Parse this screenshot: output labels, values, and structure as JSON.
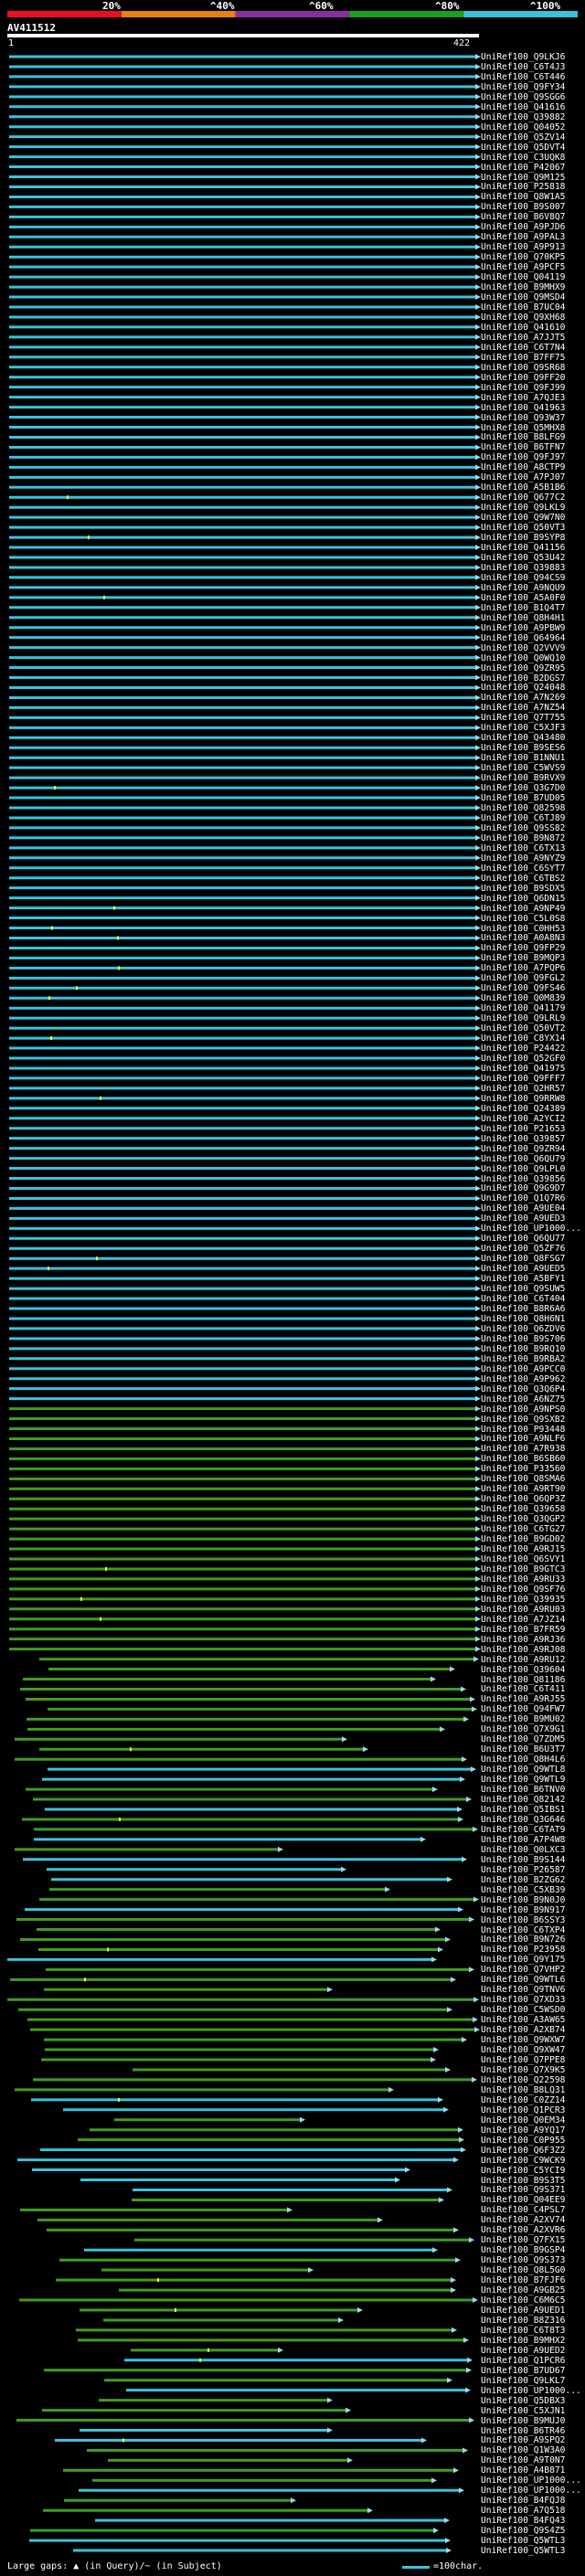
{
  "colors": {
    "scale": [
      "#e61022",
      "#e8820d",
      "#8a2da3",
      "#16a01b",
      "#39c3dd"
    ],
    "hit_cyan": "#39c3dd",
    "hit_green": "#3f9d20",
    "arrow": "#9ad8ea",
    "gap": "#f2f23a"
  },
  "scale_labels": [
    "20%",
    "^40%",
    "^60%",
    "^80%",
    "^100%"
  ],
  "query": {
    "id": "AV411512",
    "start": "1",
    "end": "422"
  },
  "legend": {
    "gaps_text": "Large gaps: ▲ (in Query)/~ (in Subject)",
    "scale_text": "=100char."
  },
  "hits": [
    "UniRef100_Q9LKJ6",
    "UniRef100_C6T4J3",
    "UniRef100_C6T446",
    "UniRef100_Q9FY34",
    "UniRef100_Q9SGG6",
    "UniRef100_Q41616",
    "UniRef100_Q39882",
    "UniRef100_Q04052",
    "UniRef100_Q5ZV14",
    "UniRef100_Q5DVT4",
    "UniRef100_C3UQK8",
    "UniRef100_P42067",
    "UniRef100_Q9M125",
    "UniRef100_P25818",
    "UniRef100_Q8W1A5",
    "UniRef100_B9S007",
    "UniRef100_B6V8Q7",
    "UniRef100_A9PJD6",
    "UniRef100_A9PAL3",
    "UniRef100_A9P913",
    "UniRef100_Q70KP5",
    "UniRef100_A9PCF5",
    "UniRef100_Q04119",
    "UniRef100_B9MHX9",
    "UniRef100_Q9MSD4",
    "UniRef100_B7UC04",
    "UniRef100_Q9XH68",
    "UniRef100_Q41610",
    "UniRef100_A7JJT5",
    "UniRef100_C6T7N4",
    "UniRef100_B7FF75",
    "UniRef100_Q9SR68",
    "UniRef100_Q9FF20",
    "UniRef100_Q9FJ99",
    "UniRef100_A7QJE3",
    "UniRef100_Q41963",
    "UniRef100_Q93W37",
    "UniRef100_Q5MHX8",
    "UniRef100_B8LFG9",
    "UniRef100_B6TFN7",
    "UniRef100_Q9FJ97",
    "UniRef100_A8CTP9",
    "UniRef100_A7PJ07",
    "UniRef100_A5B1B6",
    "UniRef100_Q677C2",
    "UniRef100_Q9LKL9",
    "UniRef100_Q9W7N0",
    "UniRef100_Q50VT3",
    "UniRef100_B9SYP8",
    "UniRef100_Q41156",
    "UniRef100_Q53U42",
    "UniRef100_Q39883",
    "UniRef100_Q94CS9",
    "UniRef100_A9NQU9",
    "UniRef100_A5A0F0",
    "UniRef100_B1Q4T7",
    "UniRef100_Q8H4H1",
    "UniRef100_A9PBW9",
    "UniRef100_Q64964",
    "UniRef100_Q2VVV9",
    "UniRef100_Q0WQ10",
    "UniRef100_Q9ZR95",
    "UniRef100_B2DGS7",
    "UniRef100_Q24048",
    "UniRef100_A7N269",
    "UniRef100_A7NZ54",
    "UniRef100_Q7T755",
    "UniRef100_C5XJF3",
    "UniRef100_Q43480",
    "UniRef100_B9SES6",
    "UniRef100_B1NNU1",
    "UniRef100_C5WVS9",
    "UniRef100_B9RVX9",
    "UniRef100_Q3G7D0",
    "UniRef100_B7UD05",
    "UniRef100_Q82598",
    "UniRef100_C6TJ89",
    "UniRef100_Q9SS82",
    "UniRef100_B9N872",
    "UniRef100_C6TX13",
    "UniRef100_A9NYZ9",
    "UniRef100_C6SYT7",
    "UniRef100_C6TBS2",
    "UniRef100_B9SDX5",
    "UniRef100_Q6DN15",
    "UniRef100_A9NP49",
    "UniRef100_C5L0S8",
    "UniRef100_C0HH53",
    "UniRef100_A0A8N3",
    "UniRef100_Q9FP29",
    "UniRef100_B9MQP3",
    "UniRef100_A7PQP6",
    "UniRef100_Q9FGL2",
    "UniRef100_Q9FS46",
    "UniRef100_Q0M839",
    "UniRef100_Q41179",
    "UniRef100_Q9LRL9",
    "UniRef100_Q50VT2",
    "UniRef100_C8YX14",
    "UniRef100_P24422",
    "UniRef100_Q52GF0",
    "UniRef100_Q41975",
    "UniRef100_Q9FFF7",
    "UniRef100_Q2HR57",
    "UniRef100_Q9RRW8",
    "UniRef100_Q24389",
    "UniRef100_A2YCI2",
    "UniRef100_P21653",
    "UniRef100_Q39857",
    "UniRef100_Q9ZR94",
    "UniRef100_Q6QU79",
    "UniRef100_Q9LPL0",
    "UniRef100_Q39856",
    "UniRef100_Q9G9D7",
    "UniRef100_Q1Q7R6",
    "UniRef100_A9UE04",
    "UniRef100_A9UED3",
    "UniRef100_UP1000...",
    "UniRef100_Q6QU77",
    "UniRef100_Q5ZF76",
    "UniRef100_Q8FSG7",
    "UniRef100_A9UED5",
    "UniRef100_A5BFY1",
    "UniRef100_Q9SUW5",
    "UniRef100_C6T404",
    "UniRef100_B8R6A6",
    "UniRef100_Q8H6N1",
    "UniRef100_Q6ZDV6",
    "UniRef100_B9S706",
    "UniRef100_B9RQ10",
    "UniRef100_B9RBA2",
    "UniRef100_A9PCC0",
    "UniRef100_A9P962",
    "UniRef100_Q3Q6P4",
    "UniRef100_A6NZ75",
    "UniRef100_A9NPS0",
    "UniRef100_Q9SXB2",
    "UniRef100_P93448",
    "UniRef100_A9NLF6",
    "UniRef100_A7R938",
    "UniRef100_B6SB60",
    "UniRef100_P33560",
    "UniRef100_Q8SMA6",
    "UniRef100_A9RT90",
    "UniRef100_Q6QP3Z",
    "UniRef100_Q39658",
    "UniRef100_Q3QGP2",
    "UniRef100_C6TG27",
    "UniRef100_B9GD02",
    "UniRef100_A9RJ15",
    "UniRef100_Q6SVY1",
    "UniRef100_B9GTC3",
    "UniRef100_A9RU33",
    "UniRef100_Q9SF76",
    "UniRef100_Q39935",
    "UniRef100_A9RU03",
    "UniRef100_A7JZ14",
    "UniRef100_B7FR59",
    "UniRef100_A9RJ36",
    "UniRef100_A9RJ08",
    "UniRef100_A9RU12",
    "UniRef100_Q39604",
    "UniRef100_Q81186",
    "UniRef100_C6T411",
    "UniRef100_A9RJ55",
    "UniRef100_Q94FW7",
    "UniRef100_B9MU02",
    "UniRef100_Q7X9G1",
    "UniRef100_Q7ZDM5",
    "UniRef100_B6U3T7",
    "UniRef100_Q8H4L6",
    "UniRef100_Q9WTL8",
    "UniRef100_Q9WTL9",
    "UniRef100_B6TNV0",
    "UniRef100_Q82142",
    "UniRef100_Q5IBS1",
    "UniRef100_Q3G646",
    "UniRef100_C6TAT9",
    "UniRef100_A7P4W8",
    "UniRef100_Q0LXC3",
    "UniRef100_B9S144",
    "UniRef100_P26587",
    "UniRef100_B2ZG62",
    "UniRef100_C5XB39",
    "UniRef100_B9N0J0",
    "UniRef100_B9N917",
    "UniRef100_B6SSY3",
    "UniRef100_C6TXP4",
    "UniRef100_B9N726",
    "UniRef100_P23958",
    "UniRef100_Q9Y175",
    "UniRef100_Q7VHP2",
    "UniRef100_Q9WTL6",
    "UniRef100_Q9TNV6",
    "UniRef100_Q7XD33",
    "UniRef100_C5WSD0",
    "UniRef100_A3AW65",
    "UniRef100_A2XB74",
    "UniRef100_Q9WXW7",
    "UniRef100_Q9XW47",
    "UniRef100_Q7PPE8",
    "UniRef100_Q7X9K5",
    "UniRef100_Q22598",
    "UniRef100_B8LQ31",
    "UniRef100_C0ZZ14",
    "UniRef100_Q1PCR3",
    "UniRef100_Q0EM34",
    "UniRef100_A9YQ17",
    "UniRef100_C0P955",
    "UniRef100_Q6F3Z2",
    "UniRef100_C9WCK9",
    "UniRef100_C5YCI9",
    "UniRef100_B9S3T5",
    "UniRef100_Q9S371",
    "UniRef100_Q04EE9",
    "UniRef100_C4PSL7",
    "UniRef100_A2XV74",
    "UniRef100_A2XVR6",
    "UniRef100_Q7FX15",
    "UniRef100_B9GSP4",
    "UniRef100_Q9S373",
    "UniRef100_Q8L5G0",
    "UniRef100_B7FJF6",
    "UniRef100_A9GB25",
    "UniRef100_C6M6C5",
    "UniRef100_A9UED1",
    "UniRef100_B8Z316",
    "UniRef100_C6T8T3",
    "UniRef100_B9MHX2",
    "UniRef100_A9UED2",
    "UniRef100_Q1PCR6",
    "UniRef100_B7UD67",
    "UniRef100_Q9LKL7",
    "UniRef100_UP1000...",
    "UniRef100_Q5DBX3",
    "UniRef100_C5XJN1",
    "UniRef100_B9MUJ0",
    "UniRef100_B6TR46",
    "UniRef100_A9SPQ2",
    "UniRef100_Q1W3A0",
    "UniRef100_A9T0N7",
    "UniRef100_A4B871",
    "UniRef100_UP1000...",
    "UniRef100_UP1000...",
    "UniRef100_B4FQJ8",
    "UniRef100_A7Q518",
    "UniRef100_B4FQ43",
    "UniRef100_Q9S4Z5",
    "UniRef100_Q5WTL3",
    "UniRef100_Q5WTL3"
  ]
}
